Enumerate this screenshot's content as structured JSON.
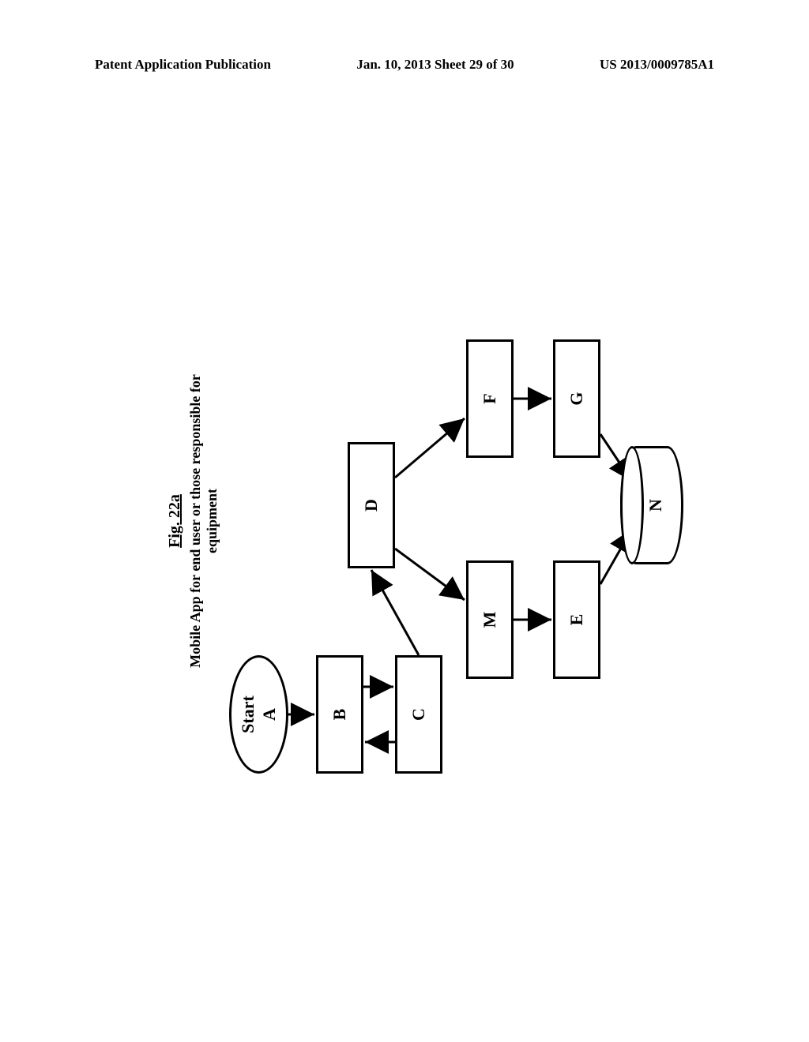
{
  "header": {
    "left": "Patent Application Publication",
    "center": "Jan. 10, 2013  Sheet 29 of 30",
    "right": "US 2013/0009785A1"
  },
  "figure": {
    "number": "Fig. 22a",
    "caption": "Mobile App for end user or those responsible for equipment"
  },
  "nodes": {
    "A": "Start\nA",
    "B": "B",
    "C": "C",
    "D": "D",
    "M": "M",
    "F": "F",
    "E": "E",
    "G": "G",
    "N": "N"
  },
  "chart_data": {
    "type": "flowchart",
    "title": "Fig. 22a — Mobile App for end user or those responsible for equipment",
    "nodes": [
      {
        "id": "A",
        "label": "Start A",
        "shape": "oval"
      },
      {
        "id": "B",
        "label": "B",
        "shape": "rect"
      },
      {
        "id": "C",
        "label": "C",
        "shape": "rect"
      },
      {
        "id": "D",
        "label": "D",
        "shape": "rect"
      },
      {
        "id": "M",
        "label": "M",
        "shape": "rect"
      },
      {
        "id": "F",
        "label": "F",
        "shape": "rect"
      },
      {
        "id": "E",
        "label": "E",
        "shape": "rect"
      },
      {
        "id": "G",
        "label": "G",
        "shape": "rect"
      },
      {
        "id": "N",
        "label": "N",
        "shape": "cylinder"
      }
    ],
    "edges": [
      {
        "from": "A",
        "to": "B"
      },
      {
        "from": "B",
        "to": "C"
      },
      {
        "from": "C",
        "to": "B"
      },
      {
        "from": "C",
        "to": "D"
      },
      {
        "from": "D",
        "to": "M"
      },
      {
        "from": "D",
        "to": "F"
      },
      {
        "from": "M",
        "to": "E"
      },
      {
        "from": "F",
        "to": "G"
      },
      {
        "from": "E",
        "to": "N"
      },
      {
        "from": "G",
        "to": "N"
      }
    ]
  }
}
